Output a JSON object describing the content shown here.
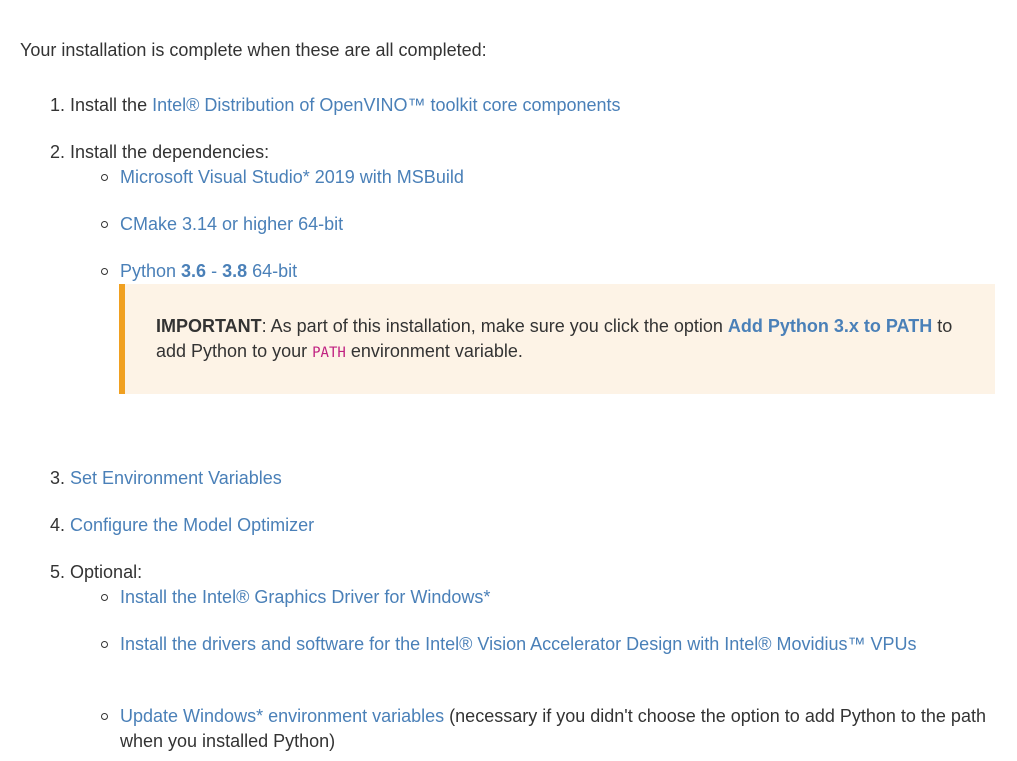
{
  "intro": "Your installation is complete when these are all completed:",
  "steps": [
    {
      "num": "1.",
      "prefix": "Install the ",
      "link": "Intel® Distribution of OpenVINO™ toolkit core components"
    },
    {
      "num": "2.",
      "text": "Install the dependencies:"
    },
    {
      "num": "3.",
      "link": "Set Environment Variables"
    },
    {
      "num": "4.",
      "link": "Configure the Model Optimizer"
    },
    {
      "num": "5.",
      "text": "Optional:"
    }
  ],
  "dependencies": {
    "msvs": "Microsoft Visual Studio* 2019 with MSBuild",
    "cmake": "CMake 3.14 or higher 64-bit",
    "python_prefix": "Python ",
    "python_min": "3.6",
    "python_dash": " - ",
    "python_max": "3.8",
    "python_suffix": " 64-bit"
  },
  "callout": {
    "label": "IMPORTANT",
    "text1": ": As part of this installation, make sure you click the option ",
    "link": "Add Python 3.x to PATH",
    "text2": " to add Python to your ",
    "code": "PATH",
    "text3": " environment variable."
  },
  "optional": {
    "graphics": "Install the Intel® Graphics Driver for Windows*",
    "vpu": "Install the drivers and software for the Intel® Vision Accelerator Design with Intel® Movidius™ VPUs",
    "env_link": "Update Windows* environment variables",
    "env_rest": " (necessary if you didn't choose the option to add Python to the path when you installed Python)"
  },
  "colors": {
    "link": "#4a80b8",
    "text": "#333333",
    "callout_bg": "#fdf3e6",
    "callout_border": "#f0a020",
    "code": "#c02080"
  }
}
